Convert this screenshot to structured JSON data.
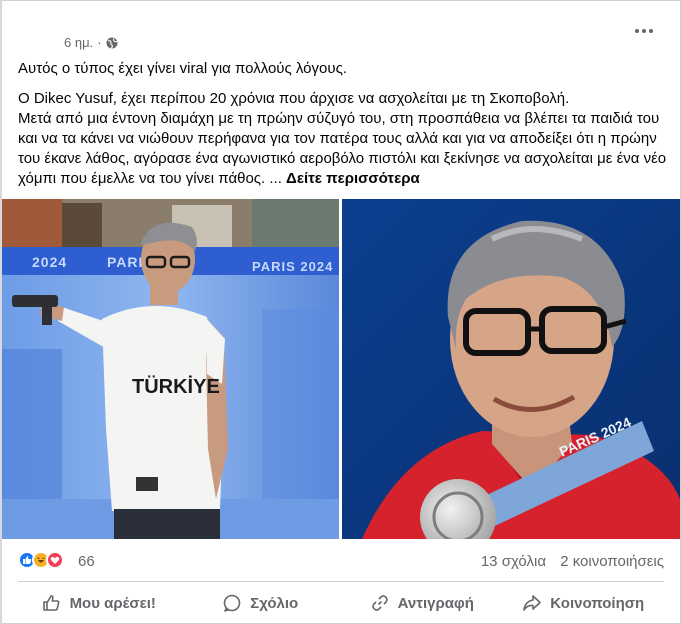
{
  "post": {
    "timestamp": "6 ημ.",
    "separator": "·",
    "audience_icon": "globe-icon",
    "paragraphs": {
      "p1": "Αυτός ο τύπος έχει γίνει viral για πολλούς λόγους.",
      "p2_line1": "Ο Dikec Yusuf, έχει περίπου 20 χρόνια που άρχισε να ασχολείται  με τη Σκοποβολή.",
      "p2_rest": "Μετά από μια έντονη διαμάχη με τη πρώην σύζυγό του, στη προσπάθεια να βλέπει τα παιδιά του και να τα κάνει να νιώθουν περήφανα για τον πατέρα τους αλλά και για να αποδείξει ότι η πρώην του έκανε λάθος, αγόρασε ένα αγωνιστικό αεροβόλο πιστόλι και ξεκίνησε να ασχολείται με ένα νέο χόμπι που έμελλε να του γίνει πάθος. ..."
    },
    "see_more": "Δείτε περισσότερα",
    "photos": {
      "left_banner_text": "PARIS 2024",
      "left_banner_year": "2024",
      "shirt_text": "TÜRKİYE",
      "ribbon_text": "PARIS 2024"
    }
  },
  "reactions": {
    "icons": [
      "like-icon",
      "haha-icon",
      "love-icon"
    ],
    "count": "66",
    "comments": "13 σχόλια",
    "shares": "2 κοινοποιήσεις"
  },
  "actions": {
    "like": "Μου αρέσει!",
    "comment": "Σχόλιο",
    "copy": "Αντιγραφή",
    "share": "Κοινοποίηση"
  },
  "colors": {
    "like_blue": "#1877f2",
    "love_red": "#f33e58",
    "haha_yellow": "#f7b125",
    "secondary_text": "#65676b"
  }
}
